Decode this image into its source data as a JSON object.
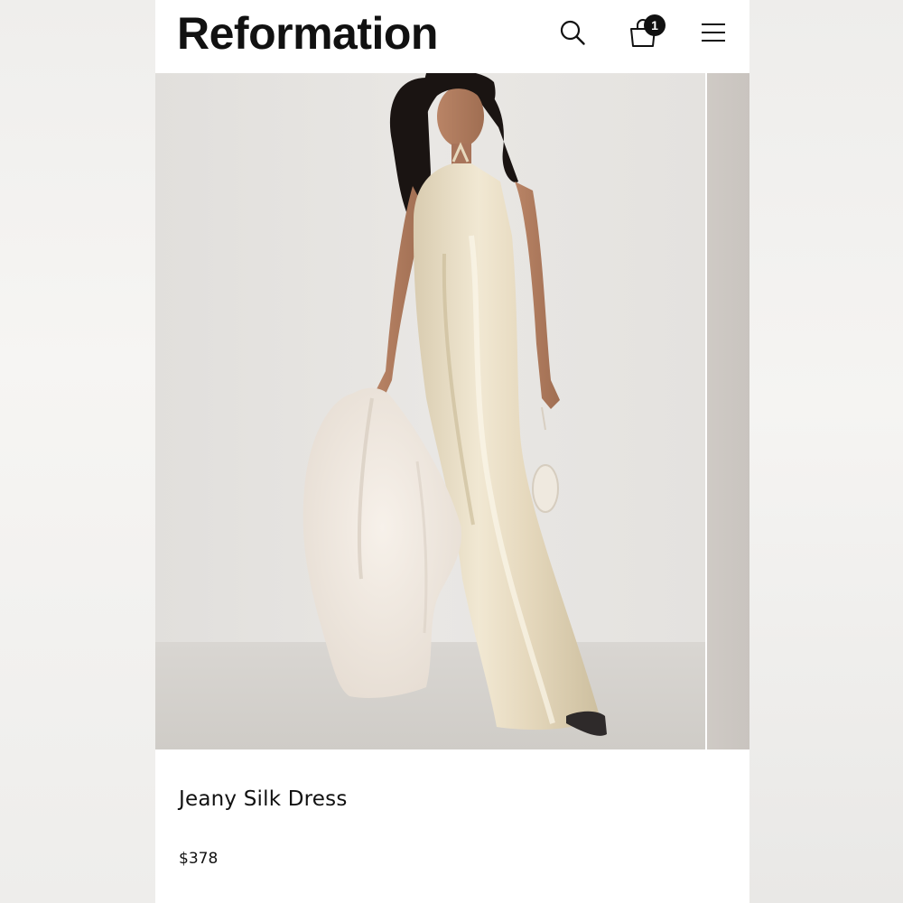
{
  "header": {
    "brand": "Reformation",
    "bag_count": "1",
    "icons": {
      "search": "search-icon",
      "bag": "shopping-bag-icon",
      "menu": "hamburger-menu-icon"
    }
  },
  "gallery": {
    "hero_image": "model-in-champagne-silk-halter-maxi-dress-holding-white-faux-fur-coat"
  },
  "product": {
    "name": "Jeany Silk Dress",
    "price": "$378"
  },
  "colors": {
    "text": "#111111",
    "background": "#ffffff",
    "dress": "#e8dcc2"
  }
}
